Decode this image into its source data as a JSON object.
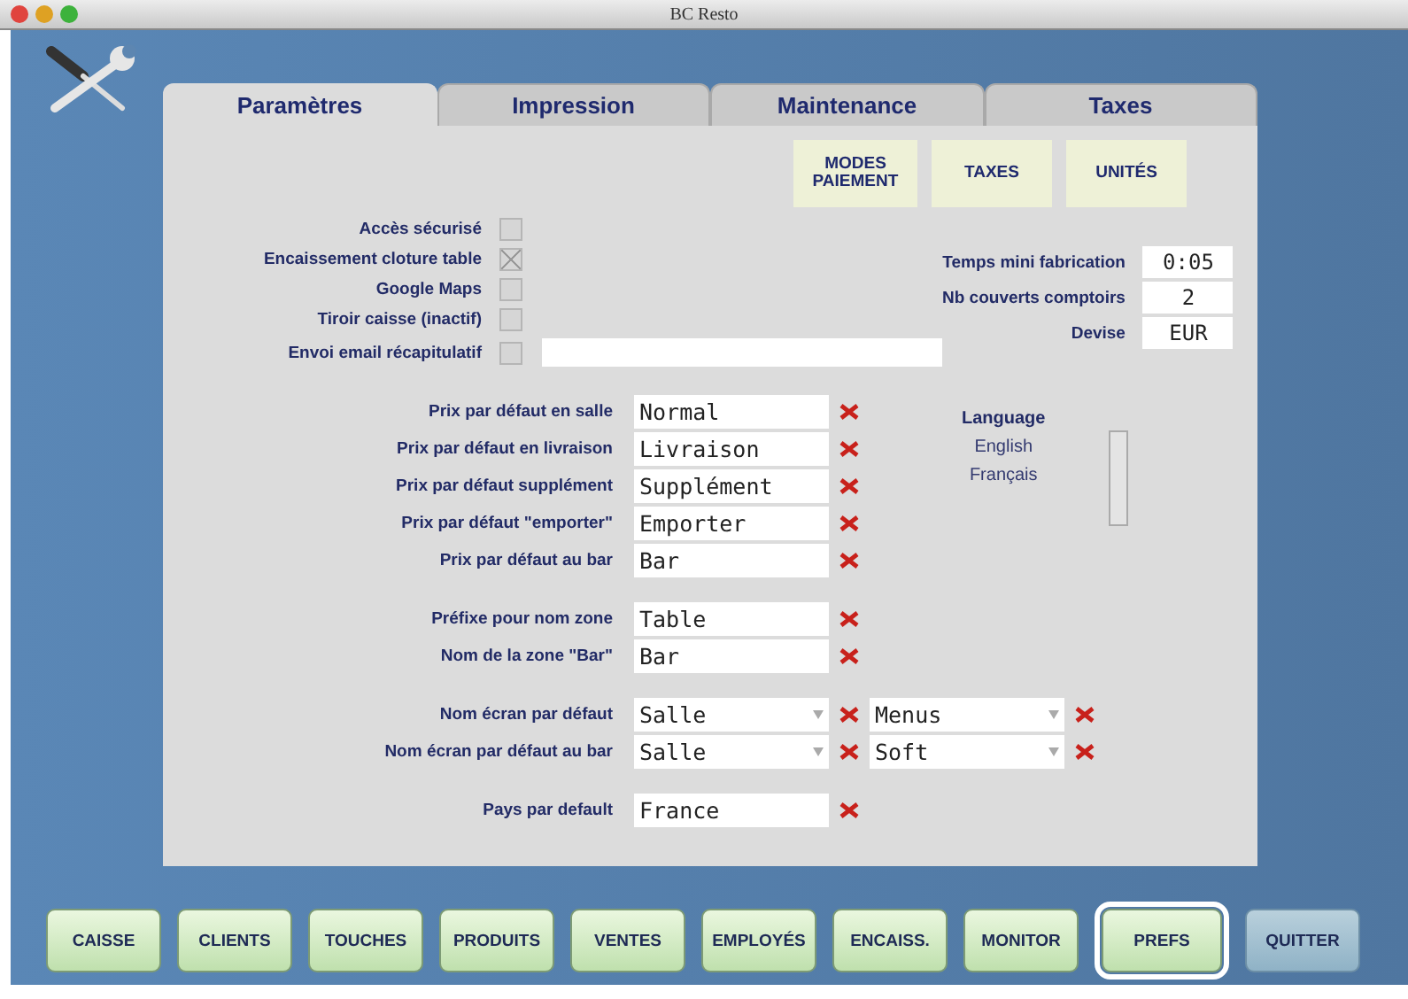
{
  "window": {
    "title": "BC Resto"
  },
  "tabs": [
    {
      "label": "Paramètres",
      "selected": true
    },
    {
      "label": "Impression",
      "selected": false
    },
    {
      "label": "Maintenance",
      "selected": false
    },
    {
      "label": "Taxes",
      "selected": false
    }
  ],
  "top_buttons": [
    "MODES\nPAIEMENT",
    "TAXES",
    "UNITÉS"
  ],
  "checkboxes": [
    {
      "label": "Accès sécurisé",
      "checked": false
    },
    {
      "label": "Encaissement cloture table",
      "checked": true
    },
    {
      "label": "Google Maps",
      "checked": false
    },
    {
      "label": "Tiroir caisse (inactif)",
      "checked": false
    },
    {
      "label": "Envoi email récapitulatif",
      "checked": false,
      "has_field": true
    }
  ],
  "settings": [
    {
      "label": "Temps mini fabrication",
      "value": "0:05"
    },
    {
      "label": "Nb couverts comptoirs",
      "value": "2"
    },
    {
      "label": "Devise",
      "value": "EUR"
    }
  ],
  "form_groups": [
    [
      {
        "label": "Prix par défaut en salle",
        "kind": "text",
        "value": "Normal"
      },
      {
        "label": "Prix par défaut en livraison",
        "kind": "text",
        "value": "Livraison"
      },
      {
        "label": "Prix par défaut supplément",
        "kind": "text",
        "value": "Supplément"
      },
      {
        "label": "Prix par défaut \"emporter\"",
        "kind": "text",
        "value": "Emporter"
      },
      {
        "label": "Prix par défaut au bar",
        "kind": "text",
        "value": "Bar"
      }
    ],
    [
      {
        "label": "Préfixe pour nom zone",
        "kind": "text",
        "value": "Table"
      },
      {
        "label": "Nom de la zone \"Bar\"",
        "kind": "text",
        "value": "Bar"
      }
    ],
    [
      {
        "label": "Nom écran par défaut",
        "kind": "dropdowns",
        "value": "Salle",
        "value_2": "Menus"
      },
      {
        "label": "Nom écran par défaut au bar",
        "kind": "dropdowns",
        "value": "Salle",
        "value_2": "Soft"
      }
    ],
    [
      {
        "label": "Pays par default",
        "kind": "text",
        "value": "France"
      }
    ]
  ],
  "language": {
    "title": "Language",
    "options": [
      "English",
      "Français"
    ]
  },
  "nav_buttons": [
    {
      "label": "CAISSE",
      "kind": "nav",
      "selected": false
    },
    {
      "label": "CLIENTS",
      "kind": "nav",
      "selected": false
    },
    {
      "label": "TOUCHES",
      "kind": "nav",
      "selected": false
    },
    {
      "label": "PRODUITS",
      "kind": "nav",
      "selected": false
    },
    {
      "label": "VENTES",
      "kind": "nav",
      "selected": false
    },
    {
      "label": "EMPLOYÉS",
      "kind": "nav",
      "selected": false
    },
    {
      "label": "ENCAISS.",
      "kind": "nav",
      "selected": false
    },
    {
      "label": "MONITOR",
      "kind": "nav",
      "selected": false
    },
    {
      "label": "PREFS",
      "kind": "nav",
      "selected": true
    },
    {
      "label": "QUITTER",
      "kind": "quit",
      "selected": false
    }
  ]
}
